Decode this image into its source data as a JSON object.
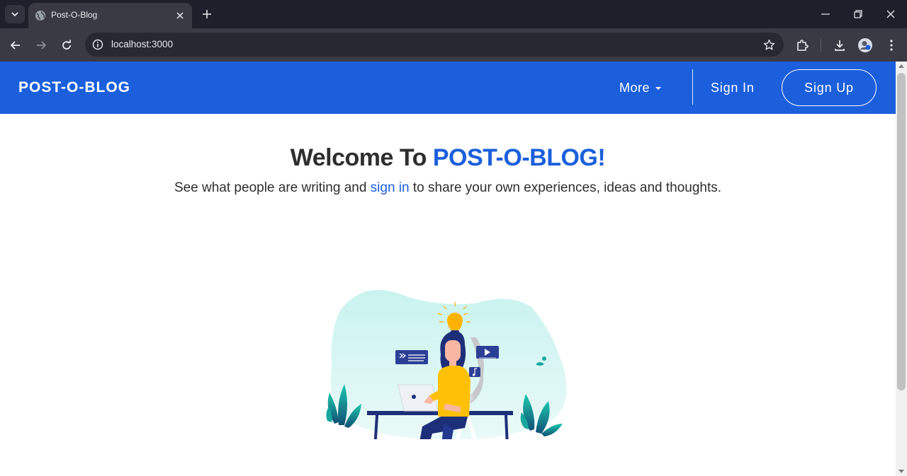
{
  "browser": {
    "tab_title": "Post-O-Blog",
    "url": "localhost:3000",
    "icons": [
      "tab-search-icon",
      "globe-icon",
      "close-icon",
      "plus-icon",
      "minimize-icon",
      "restore-icon",
      "close-window-icon",
      "back-icon",
      "forward-icon",
      "reload-icon",
      "site-info-icon",
      "star-icon",
      "extensions-icon",
      "download-icon",
      "profile-avatar",
      "kebab-menu-icon"
    ]
  },
  "navbar": {
    "brand": "POST-O-BLOG",
    "more_label": "More",
    "signin_label": "Sign In",
    "signup_label": "Sign Up",
    "background_color": "#1b5fdc"
  },
  "hero": {
    "title_prefix": "Welcome To ",
    "title_accent": "POST-O-BLOG!",
    "subtitle_before": "See what people are writing and ",
    "subtitle_link": "sign in",
    "subtitle_after": " to share your own experiences, ideas and thoughts."
  },
  "colors": {
    "accent": "#1b5fdc",
    "text": "#2e2e2e"
  }
}
